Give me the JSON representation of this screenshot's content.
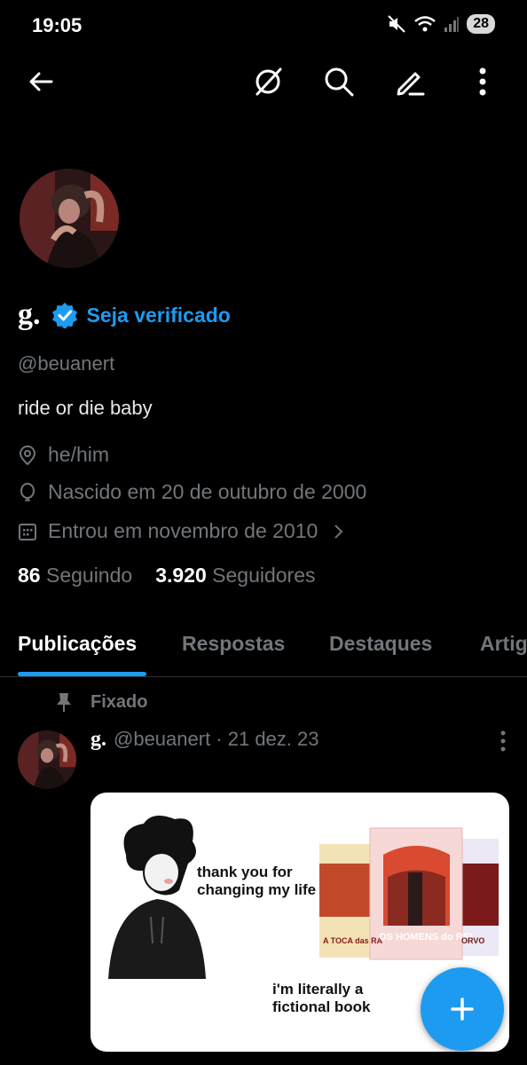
{
  "status_bar": {
    "time": "19:05",
    "battery": "28"
  },
  "profile": {
    "display_name": "g.",
    "get_verified": "Seja verificado",
    "handle": "@beuanert",
    "bio": "ride or die baby",
    "location": "he/him",
    "birthday": "Nascido em 20 de outubro de 2000",
    "joined": "Entrou em novembro de 2010",
    "following_count": "86",
    "following_label": "Seguindo",
    "followers_count": "3.920",
    "followers_label": "Seguidores"
  },
  "tabs": [
    "Publicações",
    "Respostas",
    "Destaques",
    "Artig"
  ],
  "pinned_post": {
    "pinned_label": "Fixado",
    "author_name": "g.",
    "author_meta": "@beuanert · 21 dez. 23",
    "image_text_1": "thank you for changing my life",
    "image_text_2": "i'm literally a fictional book",
    "book_titles": [
      "A TOCA das RA",
      "OS HOMENS do REI",
      "ORVO"
    ]
  },
  "colors": {
    "accent": "#1d9bf0",
    "background": "#000000",
    "muted": "#71767b"
  },
  "icons": [
    "back-arrow-icon",
    "grok-icon",
    "search-icon",
    "edit-icon",
    "more-vertical-icon",
    "location-icon",
    "birthday-icon",
    "calendar-icon",
    "pin-icon",
    "compose-plus-icon"
  ]
}
